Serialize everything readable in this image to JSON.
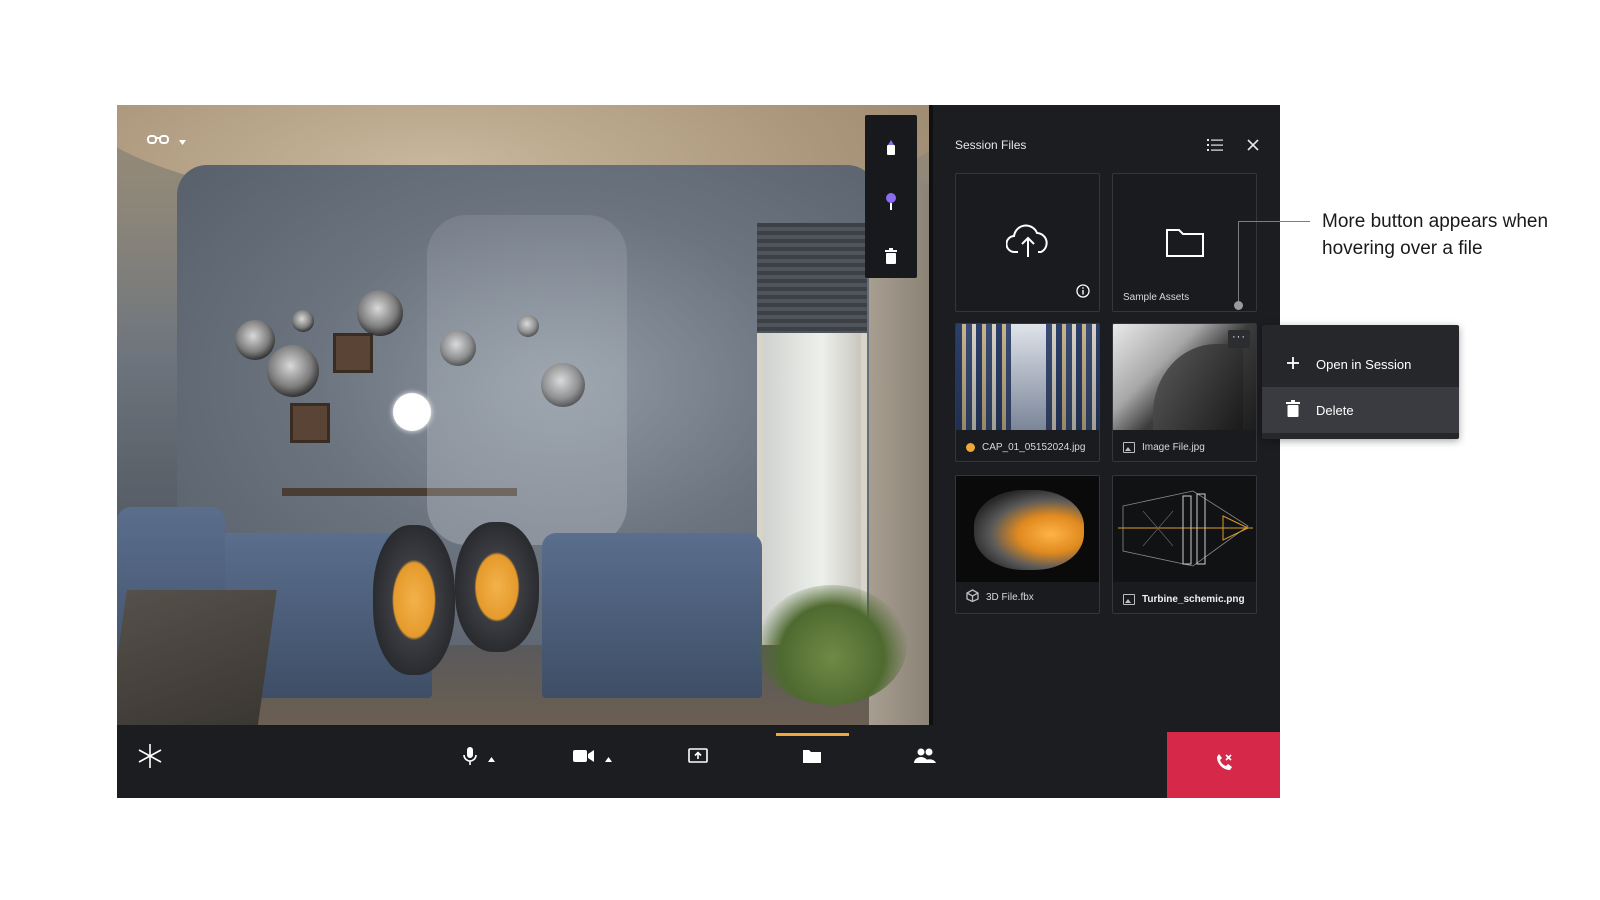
{
  "session_files": {
    "title": "Session Files",
    "upload_tile": {
      "icon": "cloud-upload-icon",
      "info_icon": "info-icon"
    },
    "folder_tile": {
      "label": "Sample Assets",
      "icon": "folder-icon"
    },
    "files": [
      {
        "name": "CAP_01_05152024.jpg",
        "status_color": "#f0a83a",
        "type": "image"
      },
      {
        "name": "Image File.jpg",
        "type": "image",
        "more_label": "···"
      },
      {
        "name": "3D File.fbx",
        "type": "3d-model"
      },
      {
        "name": "Turbine_schemic.png",
        "type": "image"
      }
    ]
  },
  "context_menu": {
    "items": [
      {
        "label": "Open in Session",
        "icon": "plus-icon"
      },
      {
        "label": "Delete",
        "icon": "trash-icon",
        "hovered": true
      }
    ]
  },
  "annotation": {
    "text": "More button appears when hovering over a file"
  },
  "toolbar": {
    "active_tab": "files",
    "accent_color": "#f0a83a",
    "end_call_color": "#d6294a"
  },
  "tools": [
    "pen-tool-icon",
    "pin-icon",
    "trash-icon"
  ]
}
